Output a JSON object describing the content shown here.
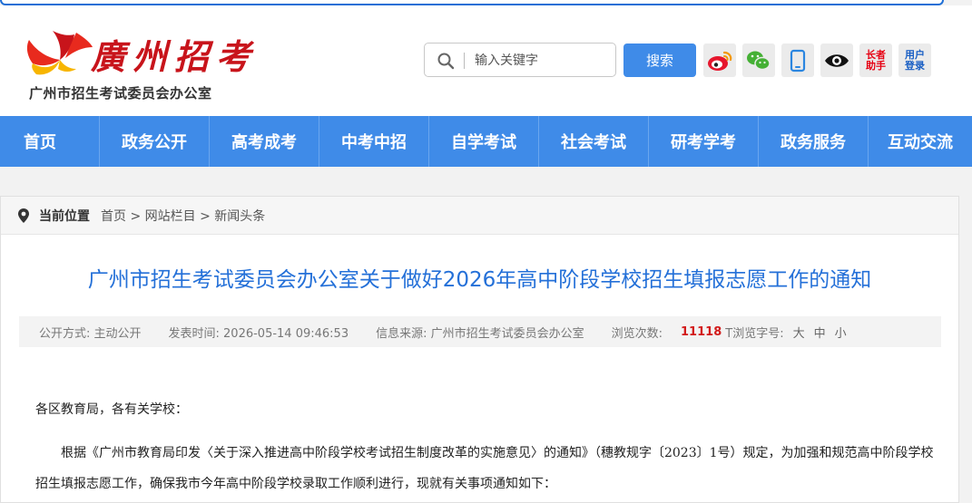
{
  "header": {
    "logo_title": "廣州招考",
    "logo_subtitle": "广州市招生考试委员会办公室"
  },
  "search": {
    "placeholder": "输入关键字",
    "button_label": "搜索"
  },
  "toolbar": {
    "elder_label": "长者助手",
    "login_label": "用户登录",
    "icons": [
      "weibo-icon",
      "wechat-icon",
      "mobile-icon",
      "eye-icon"
    ]
  },
  "nav": {
    "items": [
      "首页",
      "政务公开",
      "高考成考",
      "中考中招",
      "自学考试",
      "社会考试",
      "研考学考",
      "政务服务",
      "互动交流"
    ]
  },
  "breadcrumb": {
    "label": "当前位置",
    "path": "首页 > 网站栏目 > 新闻头条"
  },
  "article": {
    "title": "广州市招生考试委员会办公室关于做好2026年高中阶段学校招生填报志愿工作的通知",
    "meta": {
      "mode": "公开方式: 主动公开",
      "date": "发表时间: 2026-05-14 09:46:53",
      "source": "信息来源: 广州市招生考试委员会办公室",
      "views_label": "浏览次数:",
      "views": "11118",
      "fontsize_label": "T浏览字号:",
      "fontsize_options": [
        "大",
        "中",
        "小"
      ]
    },
    "greeting": "各区教育局，各有关学校：",
    "paragraph1": "根据《广州市教育局印发〈关于深入推进高中阶段学校考试招生制度改革的实施意见〉的通知》（穗教规字〔2023〕1号）规定，为加强和规范高中阶段学校招生填报志愿工作，确保我市今年高中阶段学校录取工作顺利进行，现就有关事项通知如下："
  },
  "colors": {
    "nav_blue": "#3f8be8",
    "title_blue": "#2470d8",
    "logo_red": "#c8141b",
    "views_red": "#d21b1b"
  }
}
